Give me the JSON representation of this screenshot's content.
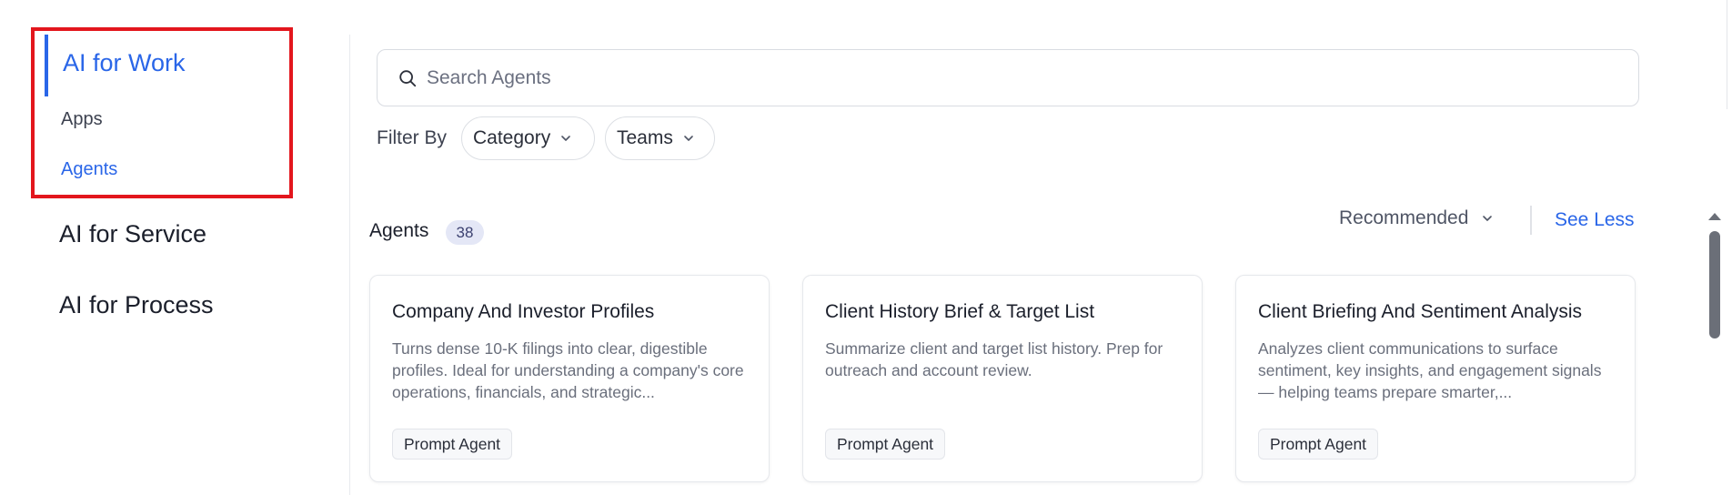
{
  "sidebar": {
    "active_section": "AI for Work",
    "active_items": [
      "Apps",
      "Agents"
    ],
    "sections": [
      "AI for Service",
      "AI for Process"
    ]
  },
  "search": {
    "placeholder": "Search Agents",
    "icon": "search-icon"
  },
  "filters": {
    "label": "Filter By",
    "options": [
      "Category",
      "Teams"
    ]
  },
  "agents": {
    "heading": "Agents",
    "count": "38",
    "sort": "Recommended",
    "see_less": "See Less",
    "cards": [
      {
        "title": "Company And Investor Profiles",
        "description": "Turns dense 10-K filings into clear, digestible profiles. Ideal for understanding a company's core operations, financials, and strategic...",
        "tag": "Prompt Agent"
      },
      {
        "title": "Client History Brief & Target List",
        "description": "Summarize client and target list history. Prep for outreach and account review.",
        "tag": "Prompt Agent"
      },
      {
        "title": "Client Briefing And Sentiment Analysis",
        "description": "Analyzes client communications to surface sentiment, key insights, and engagement signals — helping teams prepare smarter,...",
        "tag": "Prompt Agent"
      }
    ]
  },
  "colors": {
    "accent": "#2a66e8",
    "highlight": "#e3161d",
    "badge_bg": "#e4e7f6"
  }
}
